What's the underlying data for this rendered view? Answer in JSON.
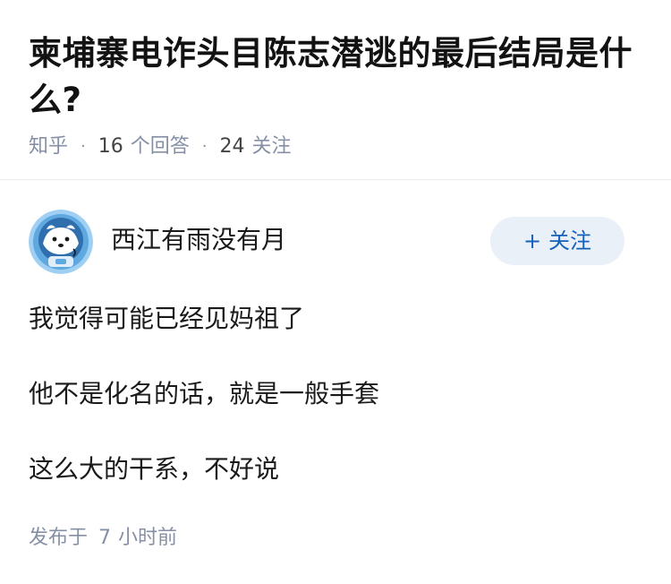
{
  "question": {
    "title": "柬埔寨电诈头目陈志潜逃的最后结局是什么?",
    "source": "知乎",
    "answers_count": "16",
    "answers_label": "个回答",
    "followers_count": "24",
    "followers_label": "关注"
  },
  "answer": {
    "author_name": "西江有雨没有月",
    "follow_plus": "+",
    "follow_label": "关注",
    "paragraphs": [
      "我觉得可能已经见妈祖了",
      "他不是化名的话，就是一般手套",
      "这么大的干系，不好说"
    ],
    "published_prefix": "发布于",
    "published_value": "7",
    "published_suffix": "小时前"
  },
  "colors": {
    "meta_gray": "#8590a6",
    "follow_bg": "#e9f0f8",
    "follow_text": "#1462b8",
    "avatar_ring": "#9fd0f3"
  }
}
